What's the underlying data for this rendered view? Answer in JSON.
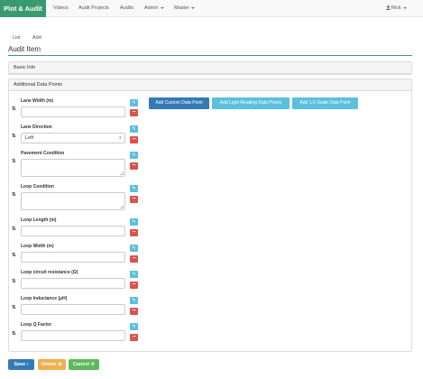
{
  "navbar": {
    "brand": "Plot & Audit",
    "links": [
      "Videos",
      "Audit Projects",
      "Audits"
    ],
    "dropdowns": [
      "Admin",
      "Master"
    ],
    "user": "Rick"
  },
  "breadcrumb": [
    "List",
    "Add"
  ],
  "page_title": "Audit Item",
  "panels": {
    "basic_info": "Basic Info",
    "additional": "Additional Data Points"
  },
  "fields": [
    {
      "label": "Lane Width (m)",
      "type": "input",
      "value": ""
    },
    {
      "label": "Lane Direction",
      "type": "select",
      "value": "Left"
    },
    {
      "label": "Pavement Condition",
      "type": "textarea",
      "value": ""
    },
    {
      "label": "Loop Condition",
      "type": "textarea",
      "value": ""
    },
    {
      "label": "Loop Length (m)",
      "type": "input",
      "value": ""
    },
    {
      "label": "Loop Width (m)",
      "type": "input",
      "value": ""
    },
    {
      "label": "Loop circuit resistance (Ω)",
      "type": "input",
      "value": ""
    },
    {
      "label": "Loop Inductance (μH)",
      "type": "input",
      "value": ""
    },
    {
      "label": "Loop Q Factor",
      "type": "input",
      "value": ""
    }
  ],
  "add_buttons": {
    "custom": "Add Custom Data Point",
    "light": "Add Light Reading Data Points",
    "scale": "Add 1-5 Scale Data Point"
  },
  "form_buttons": {
    "save": "Save",
    "delete": "Delete",
    "cancel": "Cancel"
  },
  "colors": {
    "brand": "#3a9a6f",
    "primary": "#337ab7",
    "info": "#5bc0de",
    "danger": "#d9534f",
    "warning": "#f0ad4e",
    "success": "#5cb85c"
  }
}
